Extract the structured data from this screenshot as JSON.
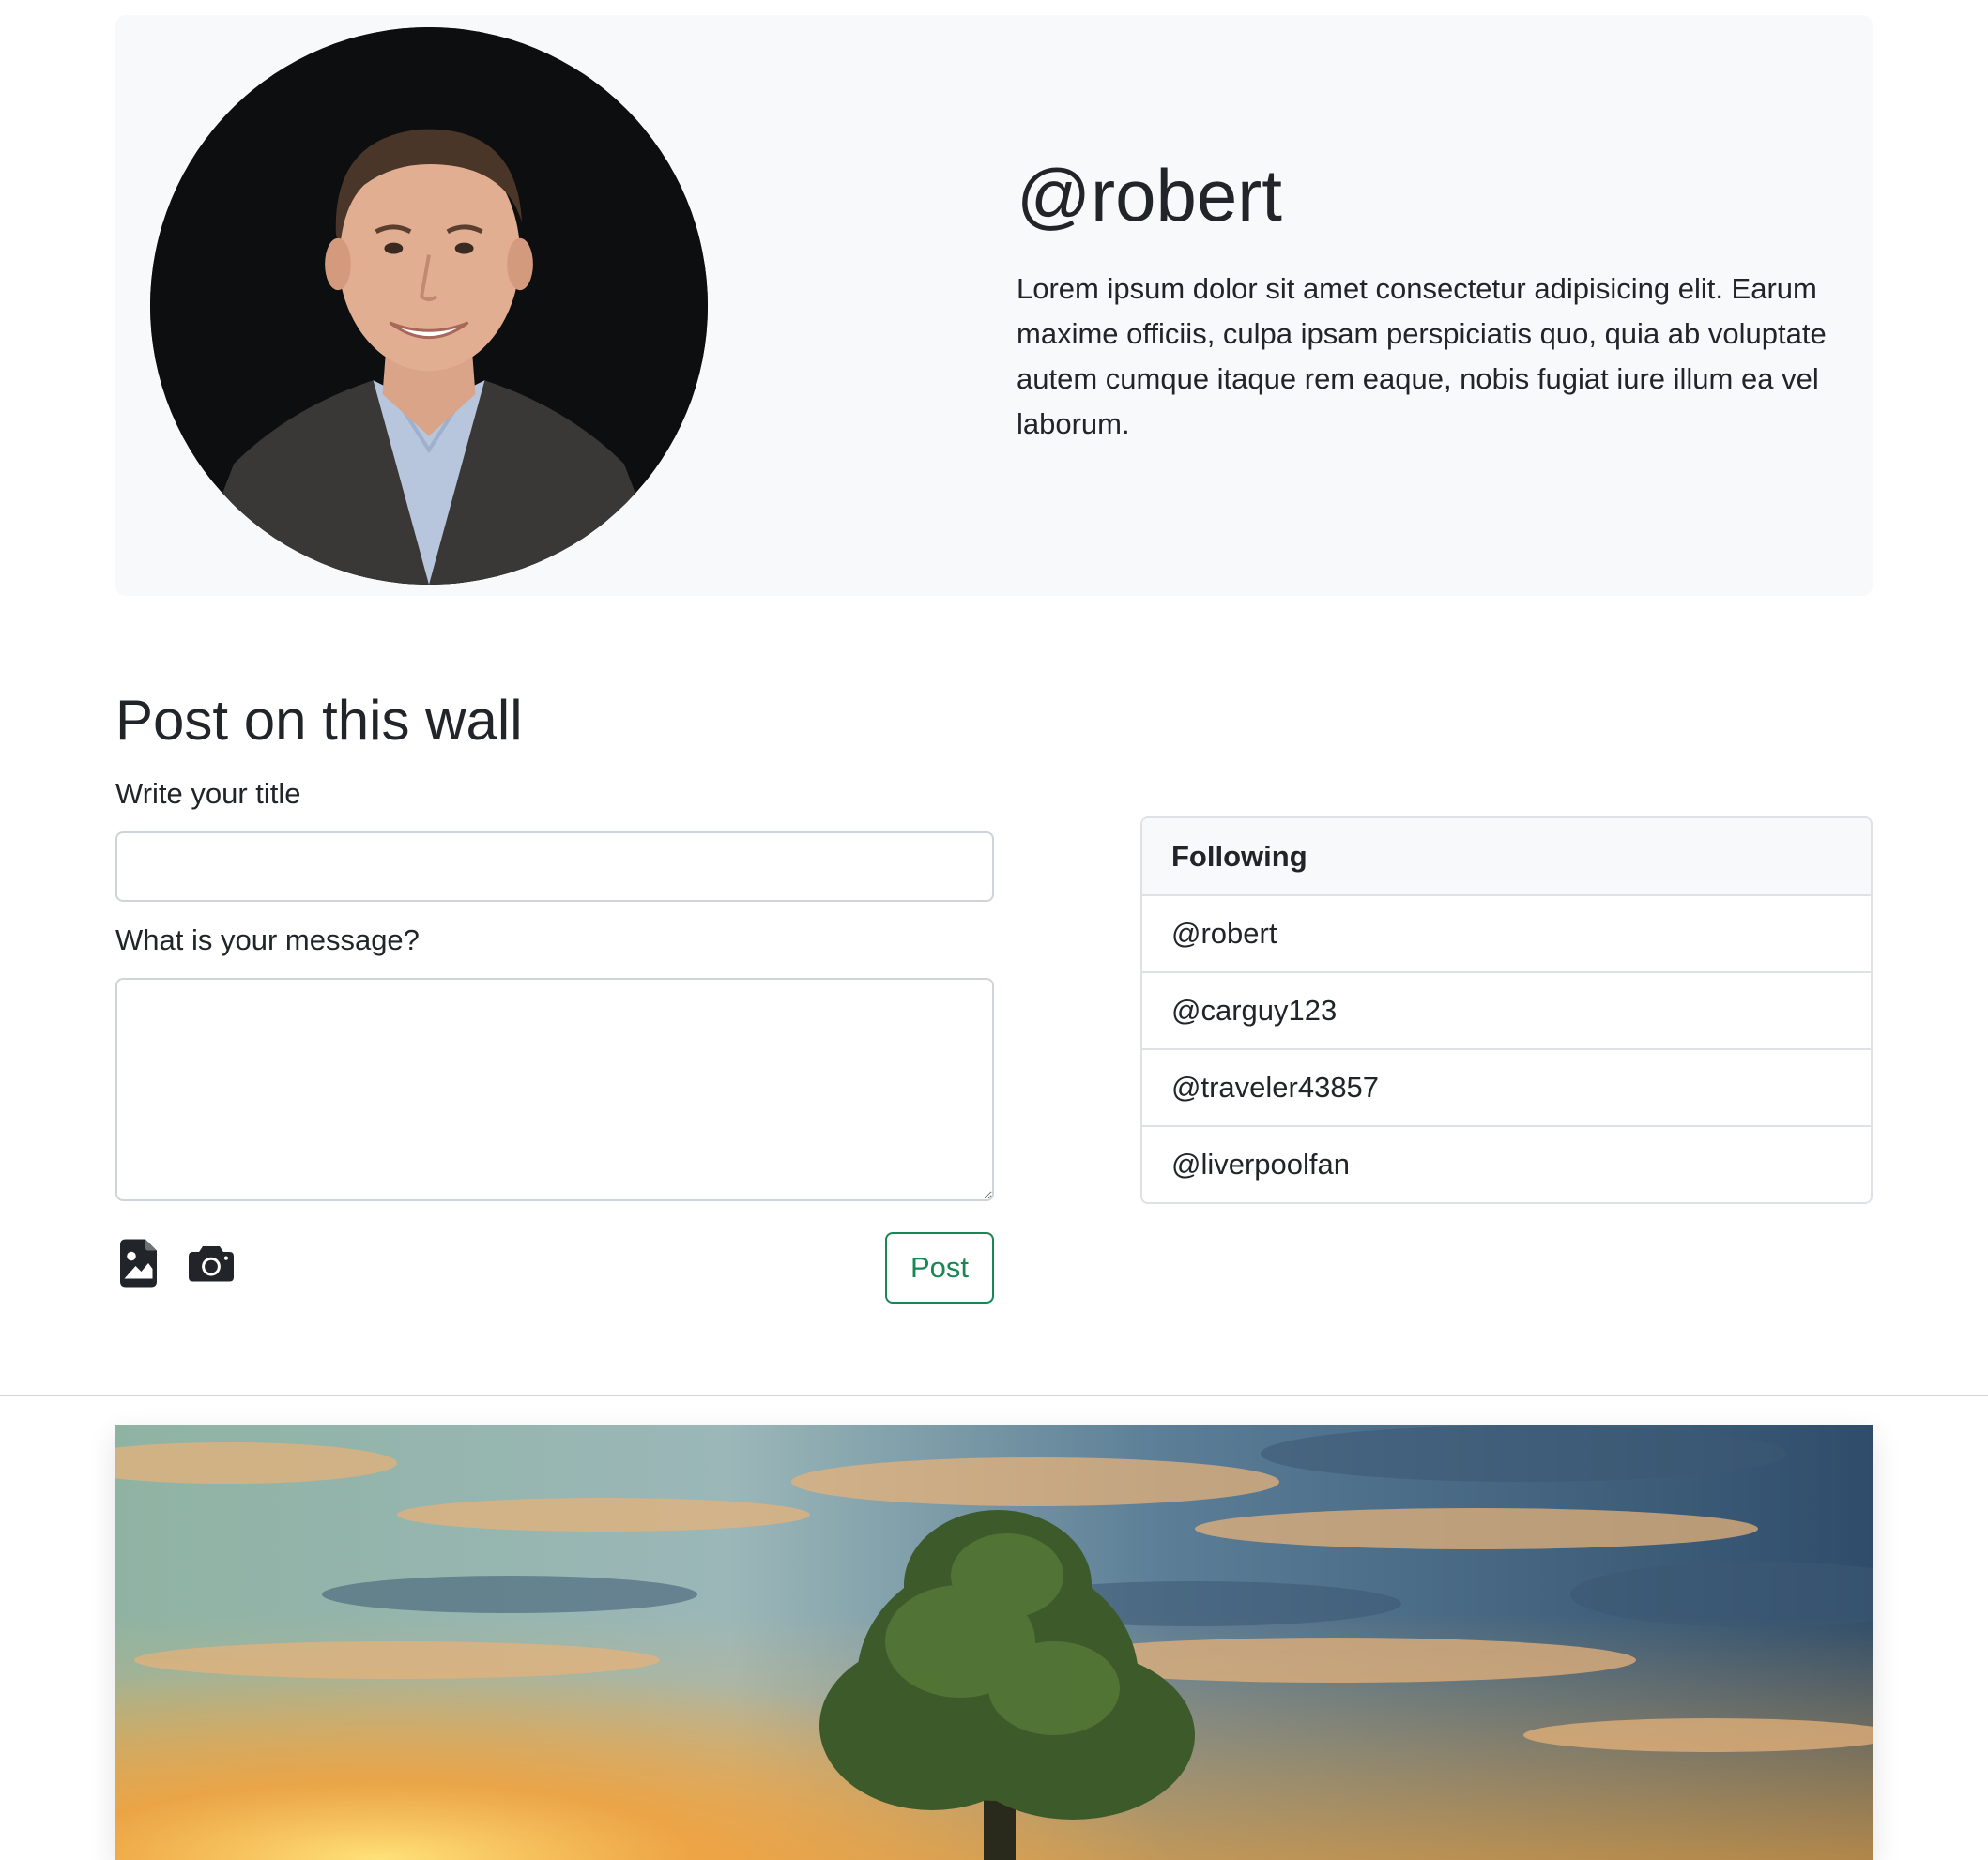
{
  "profile": {
    "handle": "@robert",
    "bio": "Lorem ipsum dolor sit amet consectetur adipisicing elit. Earum maxime officiis, culpa ipsam perspiciatis quo, quia ab voluptate autem cumque itaque rem eaque, nobis fugiat iure illum ea vel laborum.",
    "avatar_icon": "profile-photo"
  },
  "post_form": {
    "heading": "Post on this wall",
    "title_label": "Write your title",
    "title_value": "",
    "message_label": "What is your message?",
    "message_value": "",
    "attach_image_icon": "file-image-icon",
    "camera_icon": "camera-icon",
    "post_label": "Post",
    "post_color": "#198754"
  },
  "following": {
    "header": "Following",
    "items": [
      "@robert",
      "@carguy123",
      "@traveler43857",
      "@liverpoolfan"
    ]
  },
  "feed": {
    "image_icon": "landscape-tree-sunset-photo"
  },
  "colors": {
    "hero_background": "#f8f9fa",
    "border": "#dee2e6",
    "text": "#212529",
    "accent_success": "#198754"
  }
}
